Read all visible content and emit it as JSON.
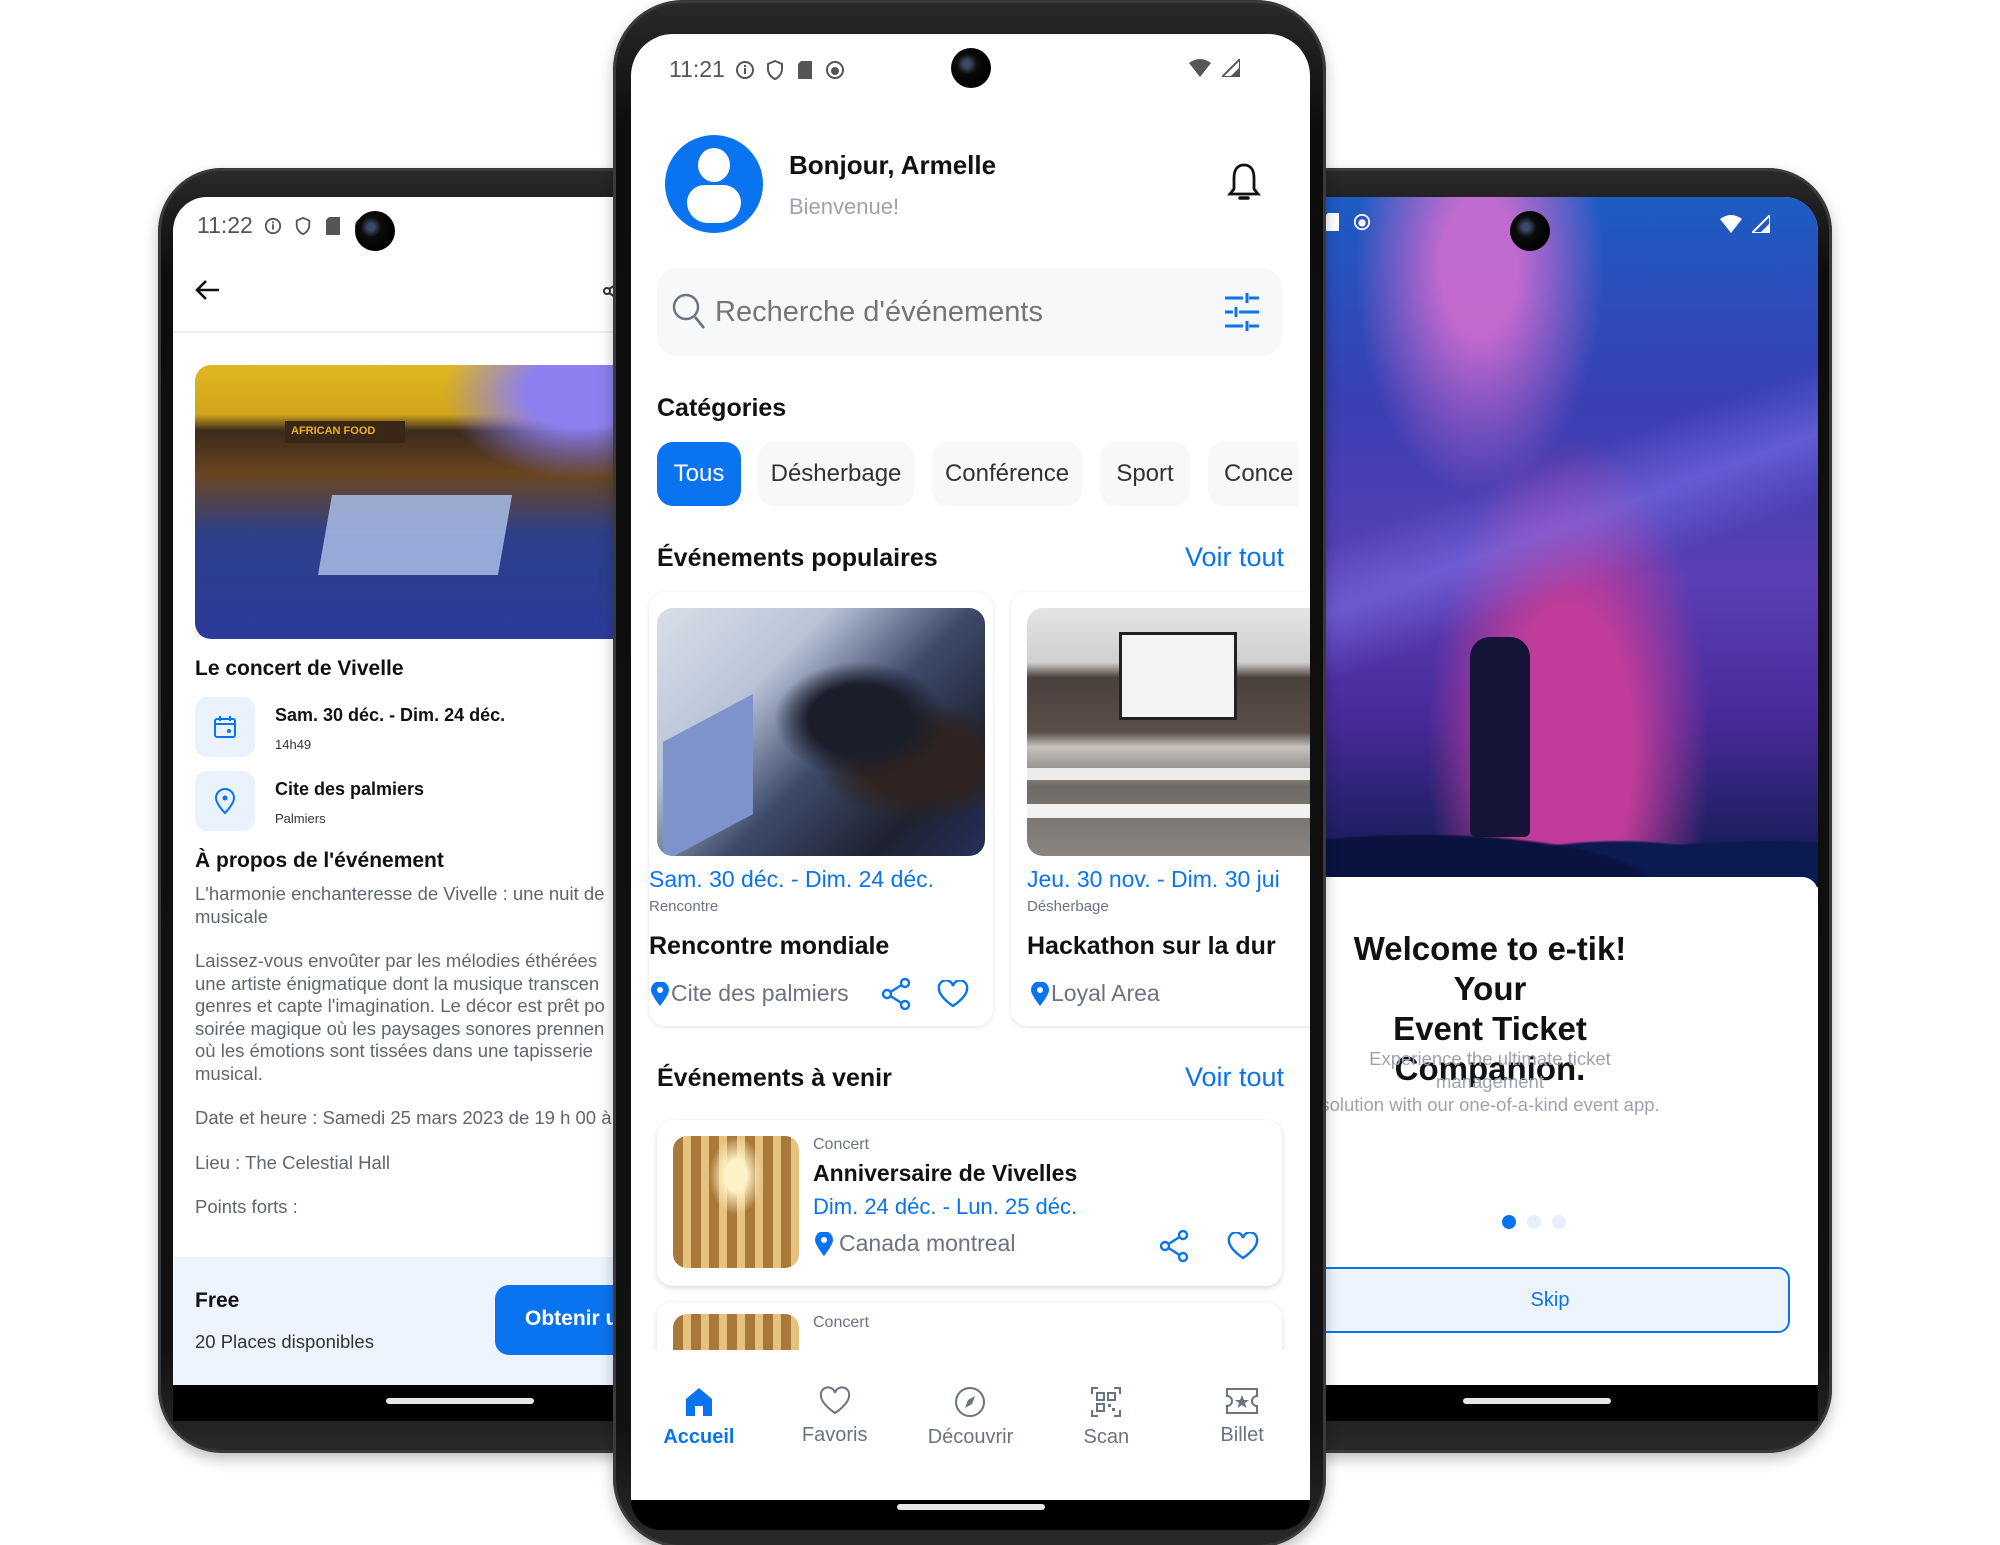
{
  "left_screen": {
    "status": {
      "time": "11:22"
    },
    "title": "Le concert de Vivelle",
    "date": {
      "main": "Sam. 30 déc. - Dim. 24 déc.",
      "sub": "14h49"
    },
    "location": {
      "main": "Cite des palmiers",
      "sub": "Palmiers"
    },
    "about_heading": "À propos de l'événement",
    "about_lines": [
      "L'harmonie enchanteresse de Vivelle : une nuit de",
      "musicale",
      "",
      "Laissez-vous envoûter par les mélodies éthérées",
      "une artiste énigmatique dont la musique transcen",
      "genres et capte l'imagination. Le décor est prêt po",
      "soirée magique où les paysages sonores prennen",
      "où les émotions sont tissées dans une tapisserie",
      "musical.",
      "",
      "Date et heure : Samedi 25 mars 2023 de 19 h 00 à",
      "",
      "Lieu : The Celestial Hall",
      "",
      "Points forts :"
    ],
    "footer": {
      "price": "Free",
      "places": "20 Places disponibles",
      "cta": "Obtenir u"
    }
  },
  "center_screen": {
    "status": {
      "time": "11:21"
    },
    "greeting": "Bonjour, Armelle",
    "welcome": "Bienvenue!",
    "search": {
      "placeholder": "Recherche d'événements"
    },
    "categories_heading": "Catégories",
    "categories": [
      {
        "label": "Tous",
        "active": true
      },
      {
        "label": "Désherbage",
        "active": false
      },
      {
        "label": "Conférence",
        "active": false
      },
      {
        "label": "Sport",
        "active": false
      },
      {
        "label": "Conce",
        "active": false
      }
    ],
    "popular": {
      "heading": "Événements populaires",
      "see_all": "Voir tout",
      "events": [
        {
          "date": "Sam. 30 déc. - Dim. 24 déc.",
          "category": "Rencontre",
          "title": "Rencontre mondiale",
          "location": "Cite des palmiers"
        },
        {
          "date": "Jeu. 30 nov. - Dim. 30 jui",
          "category": "Désherbage",
          "title": "Hackathon sur la dur",
          "location": "Loyal Area"
        }
      ]
    },
    "upcoming": {
      "heading": "Événements à venir",
      "see_all": "Voir tout",
      "events": [
        {
          "category": "Concert",
          "title": "Anniversaire de Vivelles",
          "date": "Dim. 24 déc. - Lun. 25 déc.",
          "location": "Canada montreal"
        },
        {
          "category": "Concert"
        }
      ]
    },
    "nav": [
      {
        "label": "Accueil",
        "icon": "home-icon",
        "active": true
      },
      {
        "label": "Favoris",
        "icon": "heart-icon",
        "active": false
      },
      {
        "label": "Découvrir",
        "icon": "compass-icon",
        "active": false
      },
      {
        "label": "Scan",
        "icon": "qr-scan-icon",
        "active": false
      },
      {
        "label": "Billet",
        "icon": "ticket-icon",
        "active": false
      }
    ]
  },
  "right_screen": {
    "title_line1": "Welcome to e-tik! Your",
    "title_line2": "Event Ticket Companion.",
    "subtitle_line1": "Experience the ultimate ticket management",
    "subtitle_line2": "solution with our one-of-a-kind event app.",
    "pager": {
      "pages": 3,
      "current": 1
    },
    "skip": "Skip"
  },
  "colors": {
    "accent": "#0a74f0",
    "chip_bg": "#f7f8fa",
    "info_bg": "#eaf2fe"
  }
}
